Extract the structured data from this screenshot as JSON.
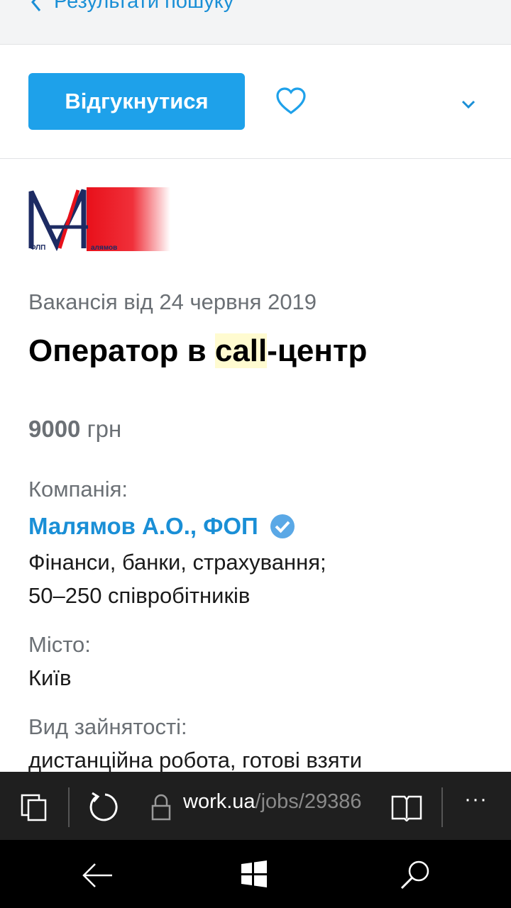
{
  "header": {
    "back_label": "Результати пошуку"
  },
  "actions": {
    "respond_label": "Відгукнутися"
  },
  "logo": {
    "left_text": "ФЛП",
    "right_text": "алямов"
  },
  "vacancy": {
    "posted": "Вакансія від 24 червня 2019",
    "title_before": "Оператор в ",
    "title_highlight": "call",
    "title_after": "-центр",
    "salary_amount": "9000",
    "salary_currency": "грн"
  },
  "company": {
    "label": "Компанія:",
    "name": "Малямов А.О., ФОП",
    "industry": "Фінанси, банки, страхування;",
    "size": "50–250 співробітників"
  },
  "city": {
    "label": "Місто:",
    "value": "Київ"
  },
  "employment": {
    "label": "Вид зайнятості:",
    "value": "дистанційна робота, готові взяти"
  },
  "browser": {
    "url_host": "work.ua",
    "url_path": "/jobs/29386",
    "more_label": "···"
  },
  "colors": {
    "accent": "#1ea1ea",
    "link": "#1a8fd6",
    "highlight": "#fffbd0"
  }
}
